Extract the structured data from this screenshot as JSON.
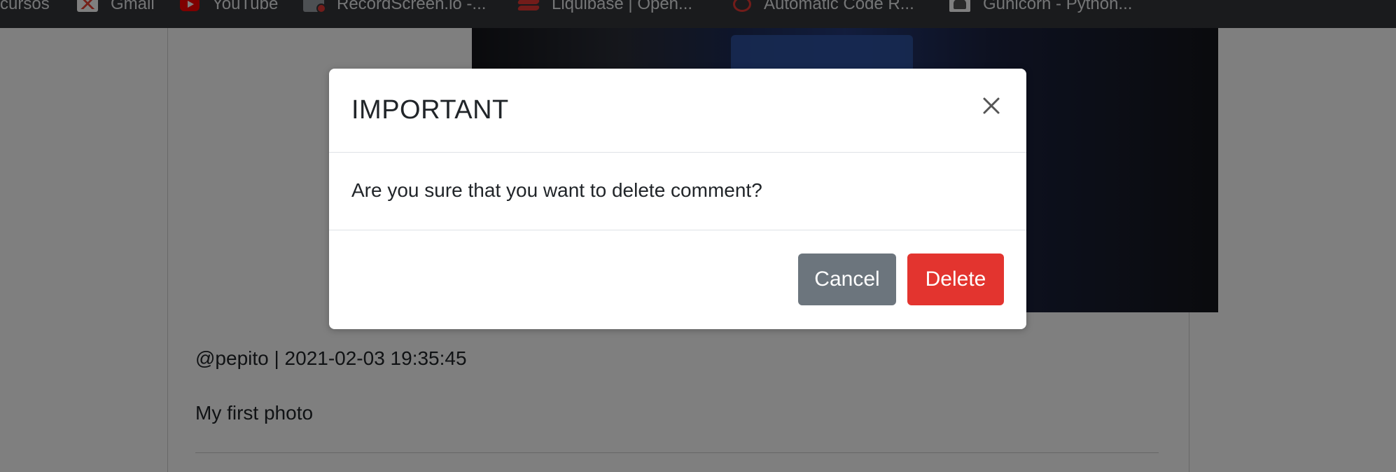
{
  "bookmarks": [
    {
      "label": "cursos",
      "icon": "folder-icon"
    },
    {
      "label": "Gmail",
      "icon": "gmail-icon"
    },
    {
      "label": "YouTube",
      "icon": "youtube-icon"
    },
    {
      "label": "RecordScreen.io -...",
      "icon": "recordscreen-icon"
    },
    {
      "label": "Liquibase | Open...",
      "icon": "liquibase-icon"
    },
    {
      "label": "Automatic Code R...",
      "icon": "automatic-code-review-icon"
    },
    {
      "label": "Gunicorn - Python...",
      "icon": "gunicorn-icon"
    }
  ],
  "post": {
    "meta": "@pepito | 2021-02-03 19:35:45",
    "caption": "My first photo"
  },
  "modal": {
    "title": "IMPORTANT",
    "message": "Are you sure that you want to delete comment?",
    "cancel_label": "Cancel",
    "delete_label": "Delete",
    "close_label": "Close"
  },
  "colors": {
    "cancel_button": "#6c757d",
    "delete_button": "#e3342f",
    "bookmarks_bar": "#35363a"
  }
}
